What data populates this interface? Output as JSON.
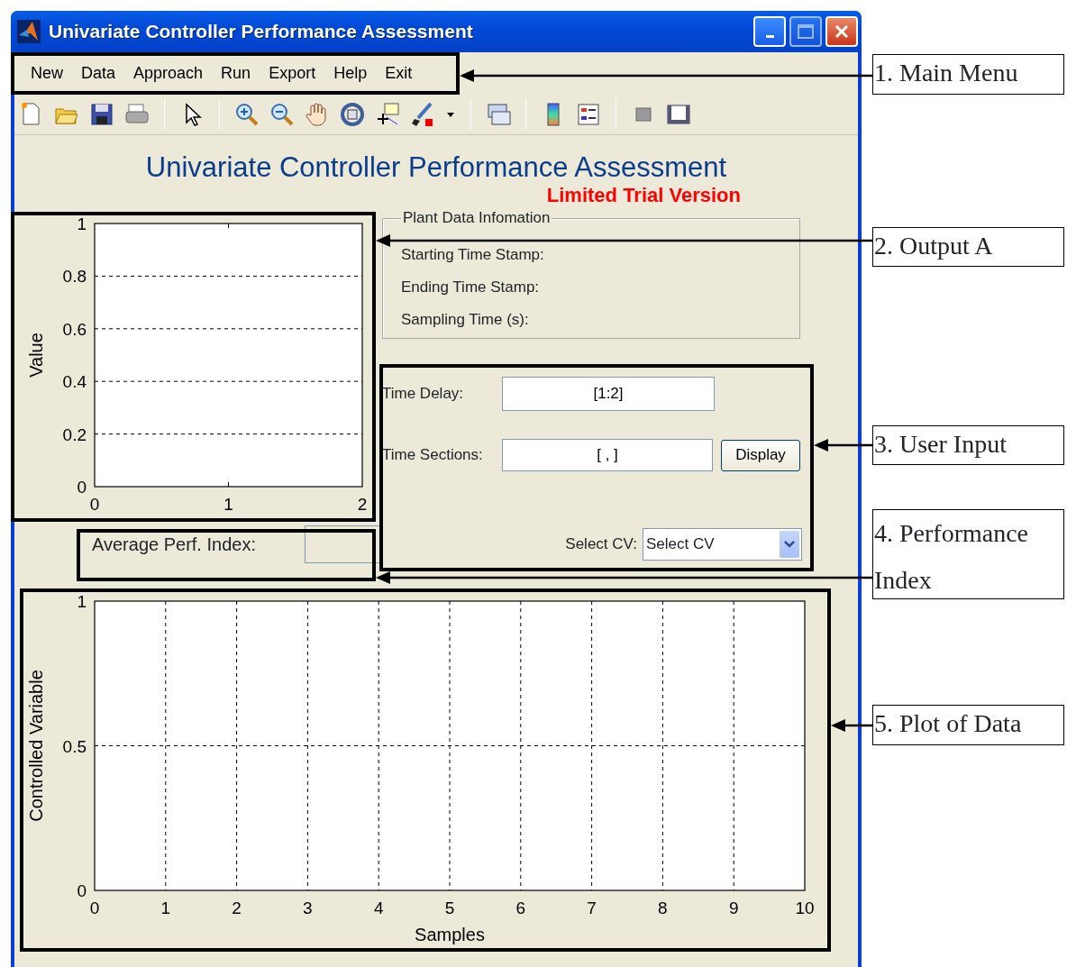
{
  "window": {
    "title": "Univariate Controller Performance Assessment"
  },
  "menu": [
    {
      "label": "New"
    },
    {
      "label": "Data"
    },
    {
      "label": "Approach"
    },
    {
      "label": "Run"
    },
    {
      "label": "Export"
    },
    {
      "label": "Help"
    },
    {
      "label": "Exit"
    }
  ],
  "header": {
    "title": "Univariate Controller Performance Assessment",
    "subtitle": "Limited Trial Version"
  },
  "output_plot": {
    "chart_data": {
      "type": "line",
      "grid": true,
      "ylabel": "Value",
      "xlim": [
        0,
        2
      ],
      "ylim": [
        0,
        1
      ],
      "xticks": [
        0,
        1,
        2
      ],
      "yticks": [
        0,
        0.2,
        0.4,
        0.6,
        0.8,
        1
      ]
    }
  },
  "plant_data": {
    "title": "Plant Data Infomation",
    "fields": [
      {
        "label": "Starting Time Stamp:"
      },
      {
        "label": "Ending Time Stamp:"
      },
      {
        "label": "Sampling Time (s):"
      }
    ]
  },
  "user_input": {
    "time_delay": {
      "label": "Time Delay:",
      "value": "[1:2]"
    },
    "time_sections": {
      "label": "Time Sections:",
      "value": "[ , ]"
    },
    "display_button": "Display",
    "select_cv": {
      "label": "Select CV:",
      "value": "Select CV"
    }
  },
  "performance": {
    "label": "Average Perf. Index:"
  },
  "data_plot": {
    "chart_data": {
      "type": "line",
      "grid": true,
      "xlabel": "Samples",
      "ylabel": "Controlled Variable",
      "xlim": [
        0,
        10
      ],
      "ylim": [
        0,
        1
      ],
      "xticks": [
        0,
        1,
        2,
        3,
        4,
        5,
        6,
        7,
        8,
        9,
        10
      ],
      "yticks": [
        0,
        0.5,
        1
      ]
    }
  },
  "annotations": [
    {
      "label": "1. Main Menu"
    },
    {
      "label": "2. Output A"
    },
    {
      "label": "3. User Input"
    },
    {
      "label": "4. Performance Index"
    },
    {
      "label": "5. Plot of Data"
    }
  ]
}
